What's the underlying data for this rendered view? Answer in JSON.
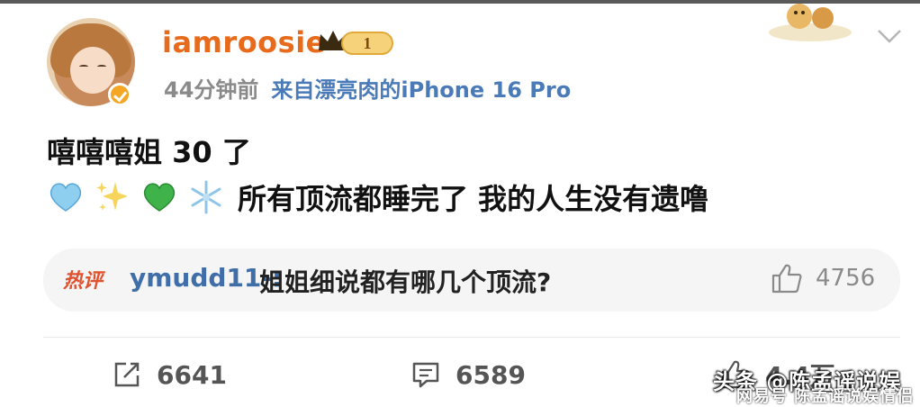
{
  "post": {
    "author": "iamroosie",
    "vip_level": "1",
    "time": "44分钟前",
    "source": "来自漂亮肉的iPhone 16 Pro",
    "line1": "嘻嘻嘻姐 30 了",
    "line2": "所有顶流都睡完了 我的人生没有遗噜",
    "emojis": [
      "blue-heart-icon",
      "sparkles-icon",
      "green-heart-icon",
      "snowflake-icon"
    ]
  },
  "hot_comment": {
    "tag": "热评",
    "user": "ymudd11-:",
    "text": "姐姐细说都有哪几个顶流?",
    "likes": "4756"
  },
  "actions": {
    "repost_count": "6641",
    "comment_count": "6589",
    "like_count": "4.4万"
  },
  "watermark": {
    "main": "头条 @陈孟谣说娱",
    "sub": "网易号 陈孟谣说娱情侣"
  },
  "colors": {
    "username": "#e86b1c",
    "link": "#3f6ea8",
    "hot_tag": "#e0512e",
    "meta": "#8a8a8a"
  }
}
